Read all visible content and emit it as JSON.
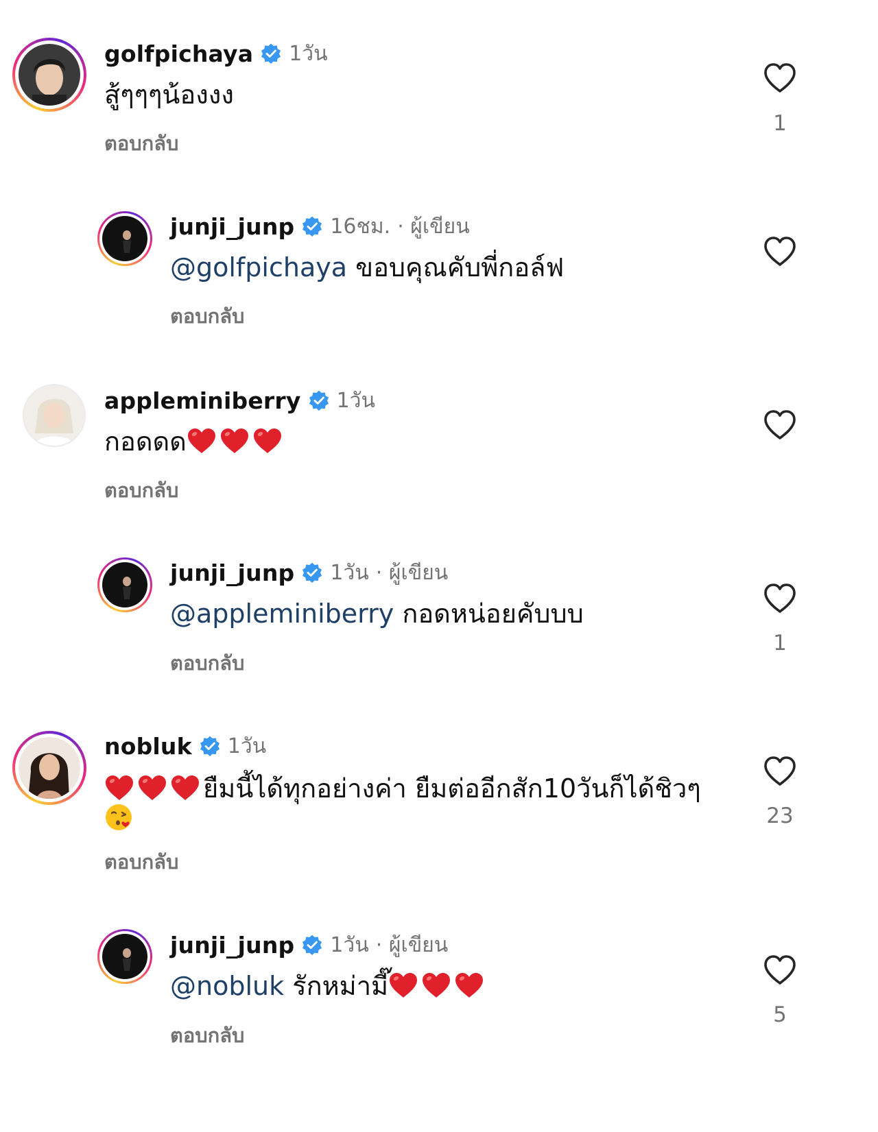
{
  "reply_label": "ตอบกลับ",
  "author_label": "· ผู้เขียน",
  "colors": {
    "verified": "#3897f0",
    "secondary_text": "#737373",
    "mention": "#1e3f66",
    "heart_emoji": "#e0202a"
  },
  "comments": [
    {
      "username": "golfpichaya",
      "time": "1วัน",
      "text": "สู้ๆๆๆน้องงง",
      "likes": "1"
    },
    {
      "username": "junji_junp",
      "time": "16ชม.",
      "mention": "@golfpichaya",
      "text": "ขอบคุณคับพี่กอล์ฟ"
    },
    {
      "username": "appleminiberry",
      "time": "1วัน",
      "text": "กอดดด"
    },
    {
      "username": "junji_junp",
      "time": "1วัน",
      "mention": "@appleminiberry",
      "text": "กอดหน่อยคับบบ",
      "likes": "1"
    },
    {
      "username": "nobluk",
      "time": "1วัน",
      "text": "ยืมนี้ได้ทุกอย่างค่า ยืมต่ออีกสัก10วันก็ได้ชิวๆ",
      "likes": "23"
    },
    {
      "username": "junji_junp",
      "time": "1วัน",
      "mention": "@nobluk",
      "text": "รักหม่ามี๊",
      "likes": "5"
    }
  ],
  "icons": {
    "verified": "verified-badge-icon",
    "like": "heart-outline-icon",
    "emoji_heart": "red-heart-emoji",
    "emoji_kiss": "face-blowing-kiss-emoji"
  }
}
